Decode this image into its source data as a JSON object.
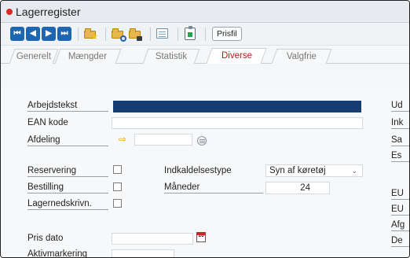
{
  "window": {
    "title": "Lagerregister"
  },
  "toolbar": {
    "prisfil": "Prisfil",
    "buttons": [
      "first-icon",
      "prev-icon",
      "next-icon",
      "last-icon",
      "new-folder-icon",
      "search-folder-icon",
      "delete-folder-icon",
      "note-icon",
      "clipboard-icon"
    ]
  },
  "tabs": [
    "Generelt",
    "Mængder",
    "Statistik",
    "Diverse",
    "Valgfrie"
  ],
  "active_tab": "Diverse",
  "form": {
    "arbejdstekst": {
      "label": "Arbejdstekst"
    },
    "ean": {
      "label": "EAN kode"
    },
    "afdeling": {
      "label": "Afdeling"
    },
    "reservering": {
      "label": "Reservering"
    },
    "bestilling": {
      "label": "Bestilling"
    },
    "lagernedskriv": {
      "label": "Lagernedskrivn."
    },
    "pris_dato": {
      "label": "Pris dato",
      "calendar_text": "10"
    },
    "aktivmarkering": {
      "label": "Aktivmarkering"
    },
    "indkaldelsestype": {
      "label": "Indkaldelsestype",
      "value": "Syn af køretøj"
    },
    "maaneder": {
      "label": "Måneder",
      "value": "24"
    }
  },
  "right_fragments": [
    "Ud",
    "Ink",
    "Sa",
    "Es",
    "EU",
    "EU",
    "Afg",
    "De"
  ]
}
